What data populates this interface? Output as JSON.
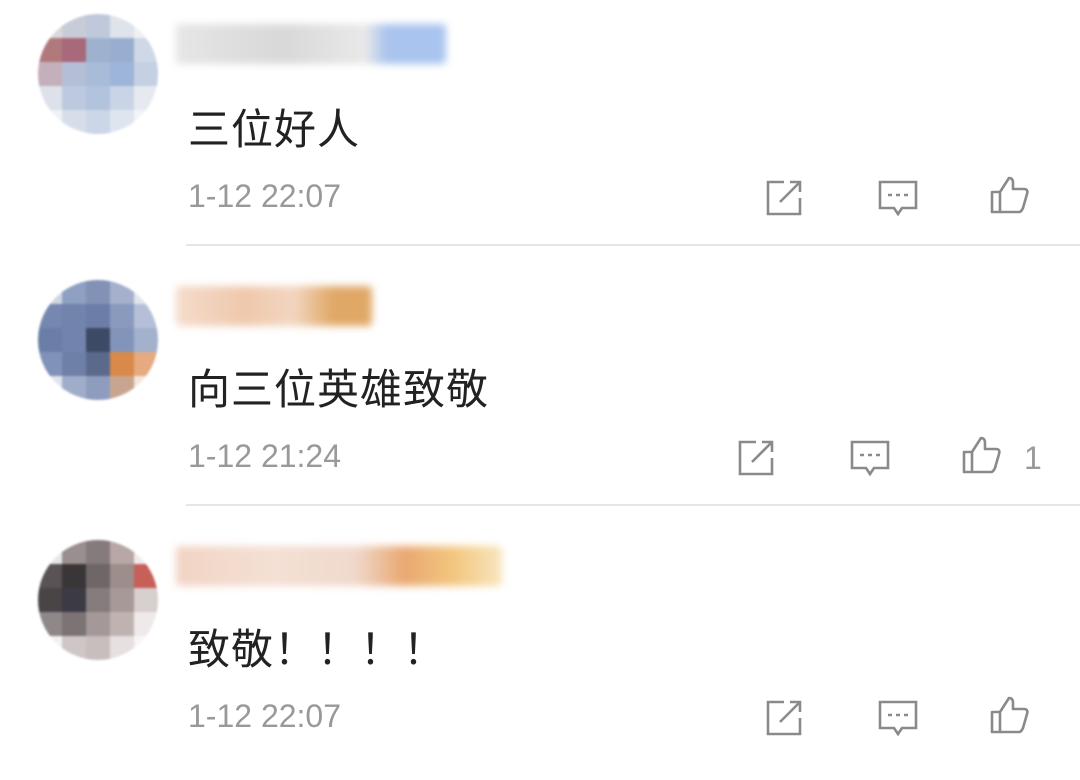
{
  "comments": [
    {
      "text": "三位好人",
      "time": "1-12 22:07",
      "likes": ""
    },
    {
      "text": "向三位英雄致敬",
      "time": "1-12 21:24",
      "likes": "1"
    },
    {
      "text": "致敬！！！！",
      "time": "1-12 22:07",
      "likes": ""
    }
  ],
  "icons": {
    "repost": "share-icon",
    "reply": "comment-icon",
    "like": "thumbs-up-icon"
  },
  "colors": {
    "text": "#222222",
    "muted": "#999999",
    "divider": "#e6e6e6"
  }
}
